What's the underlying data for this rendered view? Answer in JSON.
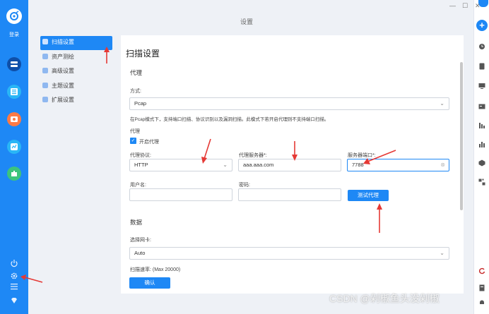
{
  "app": {
    "window_title": "设置",
    "login_label": "登录"
  },
  "window_controls": {
    "minimize": "—",
    "maximize": "☐",
    "close": "✕"
  },
  "nav": {
    "items": [
      {
        "label": "扫描设置",
        "active": true
      },
      {
        "label": "资产测绘",
        "active": false
      },
      {
        "label": "高级设置",
        "active": false
      },
      {
        "label": "主题设置",
        "active": false
      },
      {
        "label": "扩展设置",
        "active": false
      }
    ]
  },
  "panel": {
    "title": "扫描设置",
    "proxy_section": "代理",
    "mode_label": "方式:",
    "mode_value": "Pcap",
    "mode_note": "在Pcap模式下，支持端口扫描、协议识别以及漏洞扫描。此模式下若开启代理则不支持端口扫描。",
    "proxy_label": "代理",
    "enable_proxy_label": "开启代理",
    "enable_proxy_checked": true,
    "protocol_label": "代理协议:",
    "protocol_value": "HTTP",
    "server_label": "代理服务器*:",
    "server_value": "aaa.aaa.com",
    "port_label": "服务器端口*:",
    "port_value": "7788",
    "username_label": "用户名:",
    "username_value": "",
    "password_label": "密码:",
    "password_value": "",
    "test_proxy_button": "测试代理",
    "data_section": "数据",
    "nic_label": "选择网卡:",
    "nic_value": "Auto",
    "rate_label": "扫描速率: (Max 20000)",
    "confirm_button": "确认"
  },
  "watermark": "CSDN @剁椒鱼头没剁椒",
  "colors": {
    "accent": "#1e88f5",
    "arrow": "#e53935",
    "sidebar": "#1e88f5"
  },
  "icons": {
    "sidebar": [
      "logo-icon",
      "server-icon",
      "list-icon",
      "camera-icon",
      "chart-icon",
      "puzzle-icon",
      "power-icon",
      "settings-icon",
      "menu-icon",
      "diamond-icon"
    ],
    "rightbar": [
      "plus-icon",
      "clock-icon",
      "document-icon",
      "monitor-icon",
      "id-card-icon",
      "tree-icon",
      "bar-chart-icon",
      "cube-icon",
      "qr-icon",
      "refresh-icon",
      "file-icon",
      "bell-icon"
    ]
  }
}
